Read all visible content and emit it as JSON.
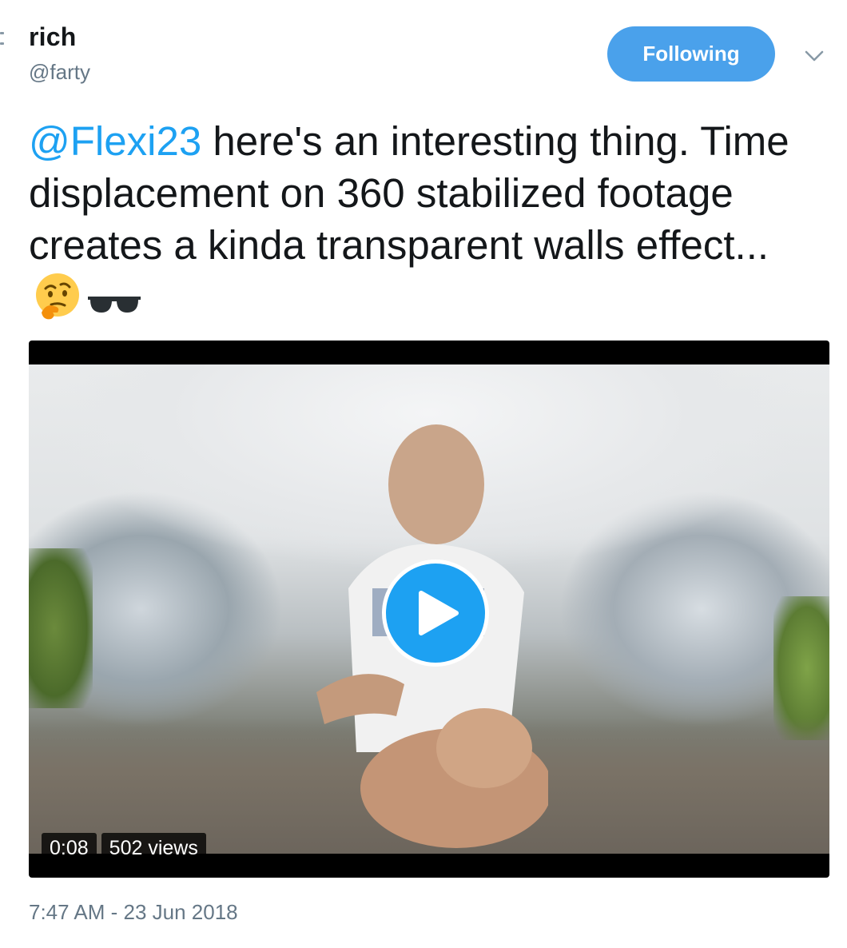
{
  "tweet": {
    "author": {
      "name": "rich",
      "handle": "@farty"
    },
    "follow_button": "Following",
    "text": {
      "mention": "@Flexi23",
      "body": " here's an interesting thing. Time displacement on 360 stabilized footage creates a kinda transparent walls effect..."
    },
    "emojis": [
      "thinking-face-emoji",
      "sunglasses-emoji"
    ],
    "video": {
      "duration": "0:08",
      "views": "502 views"
    },
    "timestamp": "7:47 AM - 23 Jun 2018"
  },
  "colors": {
    "accent": "#1da1f2",
    "follow_button_bg": "#4aa1eb",
    "muted_text": "#657786",
    "text": "#14171a"
  }
}
